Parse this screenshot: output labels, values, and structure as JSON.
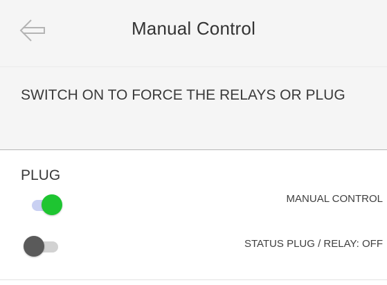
{
  "header": {
    "title": "Manual Control",
    "back_icon": "arrow-left-icon",
    "background": "#f5f5f5"
  },
  "description": {
    "text": "SWITCH ON TO FORCE THE RELAYS OR PLUG"
  },
  "plug_section": {
    "title": "PLUG",
    "manual_control": {
      "label": "MANUAL CONTROL",
      "state": "on",
      "track_color": "#c9d0f2",
      "thumb_color": "#1ec531"
    },
    "status": {
      "label": "STATUS PLUG / RELAY: OFF",
      "state": "off",
      "track_color": "#d2d2d2",
      "thumb_color": "#5a5a5a"
    }
  }
}
